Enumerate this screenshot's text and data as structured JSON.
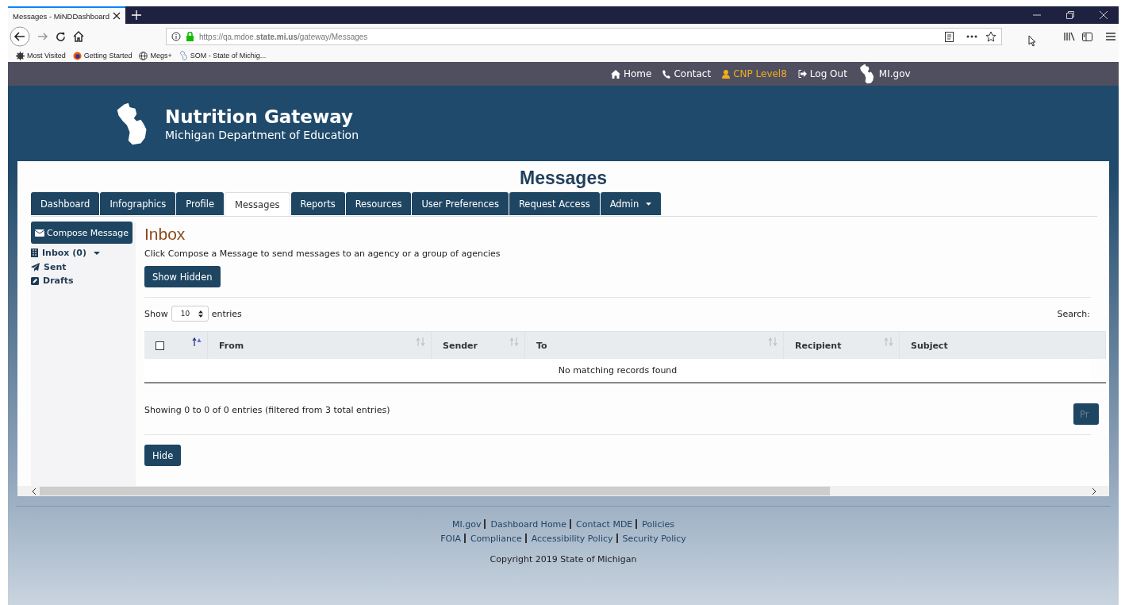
{
  "browser": {
    "tab_title": "Messages - MiNDDashboard",
    "url": "https://qa.mdoe.**state.mi.us**/gateway/Messages",
    "bookmarks": [
      {
        "label": "Most Visited",
        "kind": "gear"
      },
      {
        "label": "Getting Started",
        "kind": "firefox"
      },
      {
        "label": "Megs+",
        "kind": "globe"
      },
      {
        "label": "SOM - State of Michig...",
        "kind": "state"
      }
    ]
  },
  "top_nav": [
    {
      "label": "Home",
      "kind": "home",
      "highlighted": false
    },
    {
      "label": "Contact",
      "kind": "phone",
      "highlighted": false
    },
    {
      "label": "CNP Level8",
      "kind": "user",
      "highlighted": true
    },
    {
      "label": "Log Out",
      "kind": "logout",
      "highlighted": false
    },
    {
      "label": "MI.gov",
      "kind": "state",
      "highlighted": false
    }
  ],
  "header": {
    "title": "Nutrition Gateway",
    "subtitle": "Michigan Department of Education"
  },
  "page_title": "Messages",
  "tabs": [
    {
      "label": "Dashboard",
      "selected": false,
      "has_menu": false
    },
    {
      "label": "Infographics",
      "selected": false,
      "has_menu": false
    },
    {
      "label": "Profile",
      "selected": false,
      "has_menu": false
    },
    {
      "label": "Messages",
      "selected": true,
      "has_menu": false
    },
    {
      "label": "Reports",
      "selected": false,
      "has_menu": false
    },
    {
      "label": "Resources",
      "selected": false,
      "has_menu": false
    },
    {
      "label": "User Preferences",
      "selected": false,
      "has_menu": false
    },
    {
      "label": "Request Access",
      "selected": false,
      "has_menu": false
    },
    {
      "label": "Admin",
      "selected": false,
      "has_menu": true
    }
  ],
  "sidebar": {
    "compose_button": "Compose Message",
    "items": [
      {
        "label": "Inbox (0)",
        "kind": "inbox",
        "has_menu": true
      },
      {
        "label": "Sent",
        "kind": "sent",
        "has_menu": false
      },
      {
        "label": "Drafts",
        "kind": "drafts",
        "has_menu": false
      }
    ]
  },
  "inbox": {
    "heading": "Inbox",
    "description": "Click Compose a Message to send messages to an agency or a group of agencies",
    "show_hidden_button": "Show Hidden",
    "length": {
      "before": "Show",
      "value": "10",
      "after": "entries"
    },
    "search_label": "Search:",
    "table": {
      "columns": [
        {
          "kind": "checkbox",
          "checked": false,
          "sortable": true,
          "sorted_ascending": true
        },
        {
          "kind": "text",
          "label": "From",
          "sortable": true,
          "sorted_ascending": false
        },
        {
          "kind": "text",
          "label": "Sender",
          "sortable": true,
          "sorted_ascending": false
        },
        {
          "kind": "text",
          "label": "To",
          "sortable": true,
          "sorted_ascending": false
        },
        {
          "kind": "text",
          "label": "Recipient",
          "sortable": true,
          "sorted_ascending": false
        },
        {
          "kind": "text",
          "label": "Subject",
          "sortable": false
        }
      ],
      "empty_message": "No matching records found"
    },
    "info": "Showing 0 to 0 of 0 entries (filtered from 3 total entries)",
    "previous_button": "Pr",
    "hide_button": "Hide"
  },
  "footer": {
    "link_rows": [
      [
        "MI.gov",
        "Dashboard Home",
        "Contact MDE",
        "Policies"
      ],
      [
        "FOIA",
        "Compliance",
        "Accessibility Policy",
        "Security Policy"
      ]
    ],
    "copyright": "Copyright 2019 State of Michigan"
  }
}
